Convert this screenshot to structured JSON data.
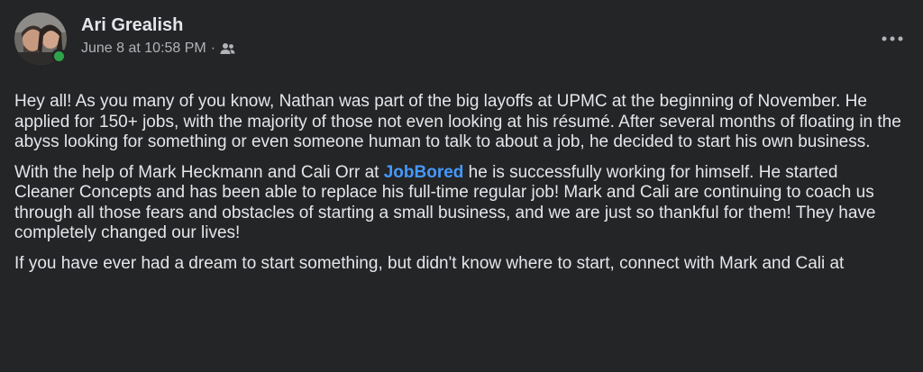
{
  "post": {
    "author": "Ari Grealish",
    "timestamp": "June 8 at 10:58 PM",
    "separator": "·",
    "audience_icon": "friends-icon",
    "more_icon": "more-horizontal-icon",
    "paragraphs": [
      {
        "text": "Hey all! As you many of you know, Nathan was part of the big layoffs at UPMC at the beginning of November. He applied for 150+ jobs, with the majority of those not even looking at his résumé. After several months of floating in the abyss looking for something or even someone human to talk to about a job, he decided to start his own business."
      },
      {
        "before": "With the help of Mark Heckmann and Cali Orr at ",
        "link": "JobBored",
        "after": " he is successfully working for himself. He started Cleaner Concepts and has been able to replace his full-time regular job! Mark and Cali are continuing to coach us through all those fears and obstacles of starting a small business, and we are just so thankful for them! They have completely changed our lives!"
      },
      {
        "text": "If you have ever had a dream to start something, but didn't know where to start, connect with Mark and Cali at"
      }
    ]
  },
  "colors": {
    "background": "#242526",
    "text": "#e4e6eb",
    "secondary": "#b0b3b8",
    "link": "#4599ff",
    "online": "#31a24c"
  }
}
